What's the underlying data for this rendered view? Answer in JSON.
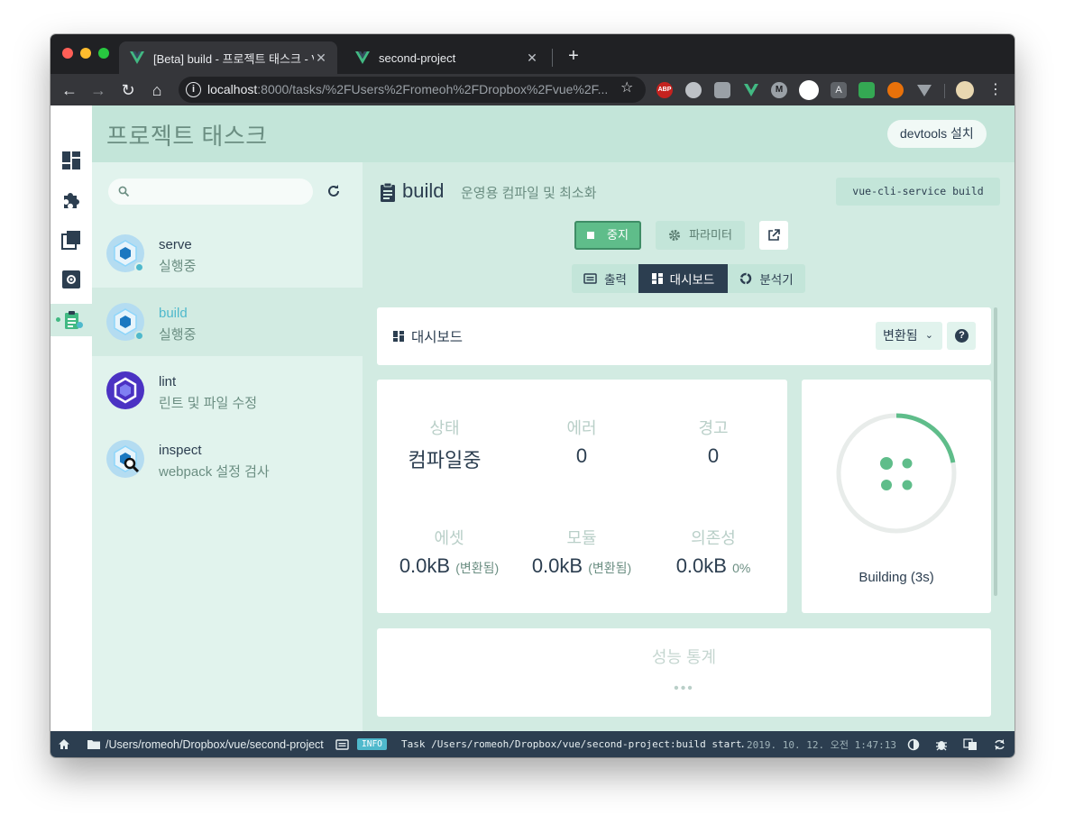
{
  "browser": {
    "tabs": [
      {
        "title": "[Beta] build - 프로젝트 태스크 - Vue UI",
        "active": true
      },
      {
        "title": "second-project",
        "active": false
      }
    ],
    "url_host": "localhost",
    "url_rest": ":8000/tasks/%2FUsers%2Fromeoh%2FDropbox%2Fvue%2F..."
  },
  "header": {
    "title": "프로젝트 태스크",
    "devtools_label": "devtools 설치"
  },
  "sidebar": {
    "search_placeholder": "",
    "tasks": [
      {
        "name": "serve",
        "desc": "실행중",
        "running": true
      },
      {
        "name": "build",
        "desc": "실행중",
        "running": true
      },
      {
        "name": "lint",
        "desc": "린트 및 파일 수정",
        "running": false
      },
      {
        "name": "inspect",
        "desc": "webpack 설정 검사",
        "running": false
      }
    ]
  },
  "task": {
    "name": "build",
    "desc": "운영용 컴파일 및 최소화",
    "command": "vue-cli-service build",
    "stop_label": "중지",
    "params_label": "파라미터",
    "views": {
      "output": "출력",
      "dashboard": "대시보드",
      "analyzer": "분석기"
    }
  },
  "dashboard": {
    "title": "대시보드",
    "mode_label": "변환됨",
    "stats": {
      "status_label": "상태",
      "status_value": "컴파일중",
      "errors_label": "에러",
      "errors_value": "0",
      "warnings_label": "경고",
      "warnings_value": "0",
      "assets_label": "에셋",
      "assets_value": "0.0kB",
      "assets_sub": "(변환됨)",
      "modules_label": "모듈",
      "modules_value": "0.0kB",
      "modules_sub": "(변환됨)",
      "deps_label": "의존성",
      "deps_value": "0.0kB",
      "deps_sub": "0%"
    },
    "progress_fraction": 0.22,
    "status_text": "Building (3s)",
    "perf_title": "성능 통계",
    "perf_placeholder": "•••"
  },
  "statusbar": {
    "path": "/Users/romeoh/Dropbox/vue/second-project",
    "log_level": "INFO",
    "log_message": "Task /Users/romeoh/Dropbox/vue/second-project:build start…",
    "log_time": "2019. 10. 12. 오전 1:47:13"
  },
  "colors": {
    "accent_green": "#42b983",
    "accent_teal": "#4fb9cc",
    "dark": "#2c3e50"
  }
}
